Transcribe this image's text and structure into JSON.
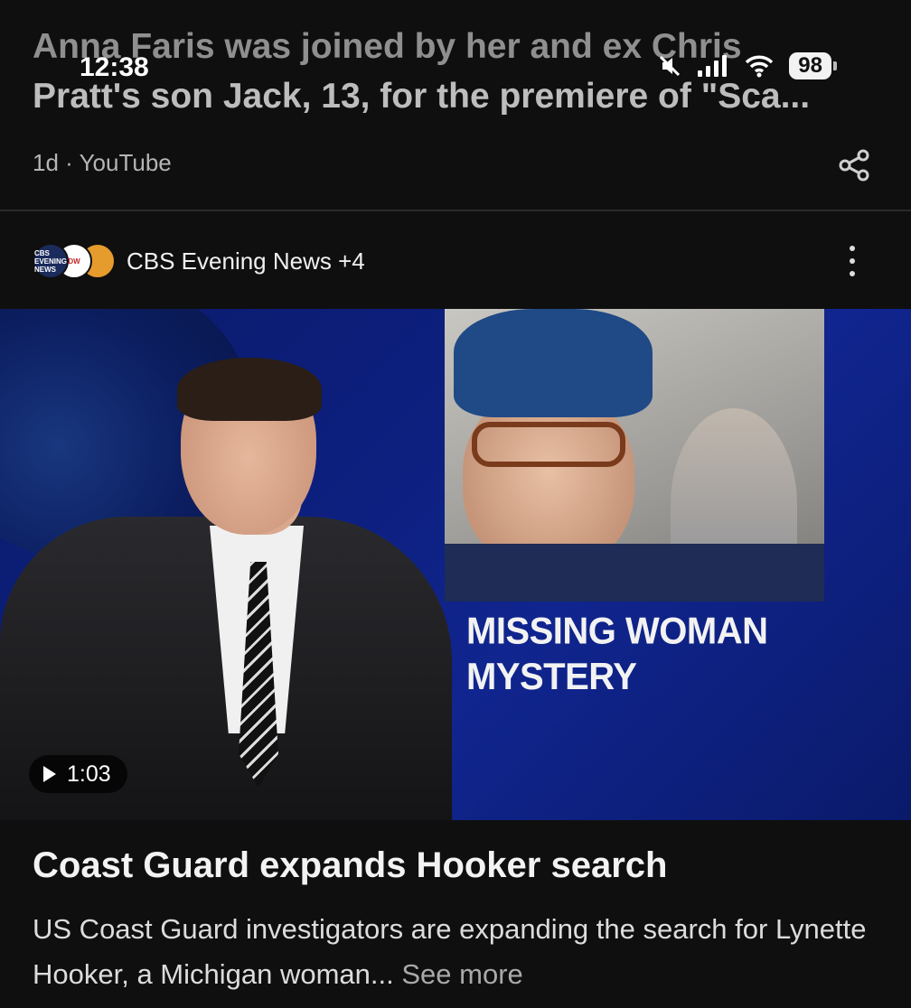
{
  "status_bar": {
    "time": "12:38",
    "battery": "98",
    "icons": [
      "mute-icon",
      "signal-icon",
      "wifi-icon",
      "battery-icon"
    ]
  },
  "prev_article": {
    "title_line1": "Anna Faris was joined by her and ex Chris",
    "title_line2": "Pratt's son Jack, 13, for the premiere of \"Sca...",
    "age": "1d",
    "separator": " · ",
    "source": "YouTube"
  },
  "card": {
    "logos": {
      "cbs": "CBS EVENING NEWS",
      "dw": "DW"
    },
    "source_label": "CBS Evening News +4",
    "video": {
      "banner_line1": "MISSING WOMAN",
      "banner_line2": "MYSTERY",
      "duration": "1:03"
    },
    "headline": "Coast Guard expands Hooker search",
    "snippet": "US Coast Guard investigators are expanding the search for Lynette Hooker, a Michigan woman...",
    "see_more": "See more"
  },
  "colors": {
    "background": "#0f0f0f",
    "thumb_blue": "#0d2080",
    "divider": "#2a2a2a"
  }
}
